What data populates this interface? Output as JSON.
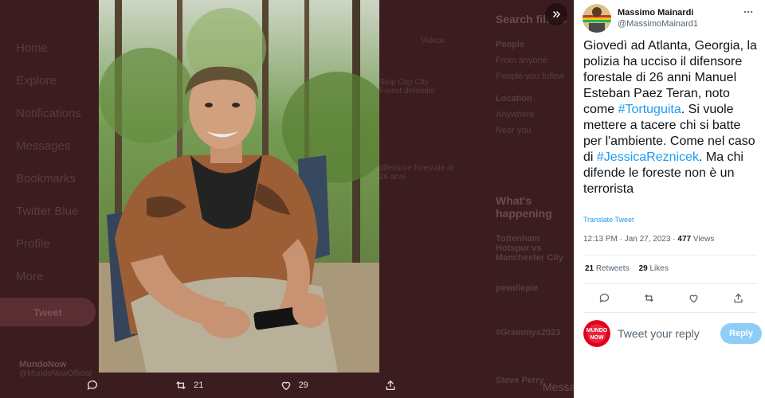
{
  "background": {
    "nav": [
      "Home",
      "Explore",
      "Notifications",
      "Messages",
      "Bookmarks",
      "Twitter Blue",
      "Profile",
      "More"
    ],
    "tweet_button": "Tweet",
    "account_name": "MundoNow",
    "account_handle": "@MundoNowOfficial",
    "right_search": "Search filters",
    "right_people": "People",
    "right_from_anyone": "From anyone",
    "right_people_follow": "People you follow",
    "right_location": "Location",
    "right_anywhere": "Anywhere",
    "right_near_you": "Near you",
    "right_whats_happening": "What's happening",
    "right_trend1": "Tottenham Hotspur vs Manchester City",
    "right_trend2": "pewdiepie",
    "right_trend3": "#Grammys2023",
    "right_trend4": "Steve Perry",
    "mid_text1": "Stop Cop City Forest defender",
    "mid_text2": "difensore forestale di 26 anni",
    "mid_videos": "Videos",
    "messages": "Messages"
  },
  "media_bar": {
    "retweets": "21",
    "likes": "29"
  },
  "author": {
    "name": "Massimo Mainardi",
    "handle": "@MassimoMainard1"
  },
  "tweet": {
    "text_1": "Giovedì ad Atlanta, Georgia, la polizia ha ucciso il difensore forestale di 26 anni Manuel Esteban Paez Teran, noto come ",
    "hashtag_1": "#Tortuguita",
    "text_2": ".  Si vuole mettere a tacere chi si batte per l'ambiente. Come nel caso di ",
    "hashtag_2": "#JessicaReznicek",
    "text_3": ". Ma chi difende le foreste non è un terrorista",
    "translate": "Translate Tweet",
    "timestamp": "12:13 PM · Jan 27, 2023 · ",
    "views_count": "477",
    "views_label": " Views"
  },
  "stats": {
    "retweets_count": "21",
    "retweets_label": " Retweets",
    "likes_count": "29",
    "likes_label": " Likes"
  },
  "reply": {
    "placeholder": "Tweet your reply",
    "button": "Reply",
    "avatar_text": "MUNDO NOW"
  },
  "colors": {
    "accent": "#1d9bf0",
    "reply_button": "#8ecdf8",
    "overlay": "#3c1d1f"
  }
}
